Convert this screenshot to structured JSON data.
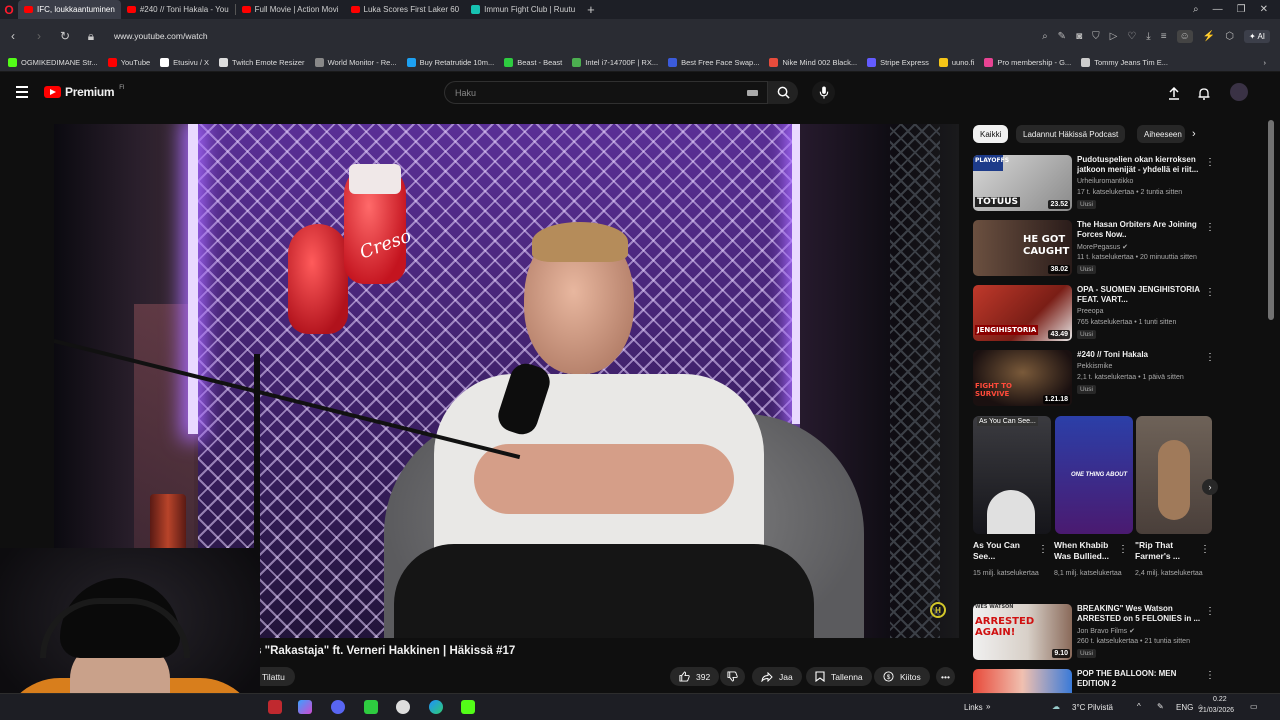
{
  "browser": {
    "tabs": [
      {
        "label": "IFC, loukkaantuminen"
      },
      {
        "label": "#240 // Toni Hakala - You"
      },
      {
        "label": "Full Movie | Action Movi"
      },
      {
        "label": "Luka Scores First Laker 60"
      },
      {
        "label": "Immun Fight Club | Ruutu"
      }
    ],
    "url": "www.youtube.com/watch",
    "ai_label": "AI",
    "bookmarks": [
      {
        "label": "OGMIKEDIMANE Str...",
        "color": "#53fc18"
      },
      {
        "label": "YouTube",
        "color": "#ff0000"
      },
      {
        "label": "Etusivu / X",
        "color": "#ffffff"
      },
      {
        "label": "Twitch Emote Resizer",
        "color": "#dddddd"
      },
      {
        "label": "World Monitor - Re...",
        "color": "#888888"
      },
      {
        "label": "Buy Retatrutide 10m...",
        "color": "#1da1f2"
      },
      {
        "label": "Beast - Beast",
        "color": "#2ecc40"
      },
      {
        "label": "Intel i7-14700F | RX...",
        "color": "#4caf50"
      },
      {
        "label": "Best Free Face Swap...",
        "color": "#3b5bdb"
      },
      {
        "label": "Nike Mind 002 Black...",
        "color": "#e74c3c"
      },
      {
        "label": "Stripe Express",
        "color": "#635bff"
      },
      {
        "label": "uuno.fi",
        "color": "#f5c518"
      },
      {
        "label": "Pro membership - G...",
        "color": "#e84393"
      },
      {
        "label": "Tommy Jeans Tim E...",
        "color": "#cccccc"
      }
    ]
  },
  "youtube": {
    "logo_text": "Premium",
    "logo_sup": "FI",
    "search_placeholder": "Haku",
    "video": {
      "title": "onen vs \"Rakastaja\" ft. Verneri Hakkinen | Häkissä #17",
      "channel_fragment": "n",
      "subscribe_label": "Tilattu",
      "likes": "392",
      "share_label": "Jaa",
      "save_label": "Tallenna",
      "thanks_label": "Kiitos",
      "glove_brand": "Creso"
    },
    "chips": [
      "Kaikki",
      "Ladannut Häkissä Podcast",
      "Aiheeseen"
    ],
    "recommendations": [
      {
        "title": "Pudotuspelien okan kierroksen jatkoon menijät - yhdellä ei riit...",
        "channel": "Urheiluromantikko",
        "meta": "17 t. katselukertaa • 2 tuntia sitten",
        "badge": "Uusi",
        "duration": "23.52",
        "thumb_text": "TOTUUS",
        "thumb_top": "PLAYOFFS"
      },
      {
        "title": "The Hasan Orbiters Are Joining Forces Now..",
        "channel": "MorePegasus",
        "meta": "11 t. katselukertaa • 20 minuuttia sitten",
        "badge": "Uusi",
        "duration": "38.02",
        "thumb_text": "HE GOT CAUGHT"
      },
      {
        "title": "OPA - SUOMEN JENGIHISTORIA FEAT. VART...",
        "channel": "Preeopa",
        "meta": "765 katselukertaa • 1 tunti sitten",
        "badge": "Uusi",
        "duration": "43.49",
        "thumb_text": "JENGIHISTORIA"
      },
      {
        "title": "#240 // Toni Hakala",
        "channel": "Pekkismike",
        "meta": "2,1 t. katselukertaa • 1 päivä sitten",
        "badge": "Uusi",
        "duration": "1.21.18",
        "thumb_text": "FIGHT TO SURVIVE"
      }
    ],
    "shorts": [
      {
        "title": "As You Can See...",
        "views": "15 milj. katselukertaa",
        "overlay": "As You Can See..."
      },
      {
        "title": "When Khabib Was Bullied...",
        "views": "8,1 milj. katselukertaa",
        "overlay": "ONE THING ABOUT"
      },
      {
        "title": "\"Rip That Farmer's ...",
        "views": "2,4 milj. katselukertaa",
        "overlay": ""
      }
    ],
    "recommendations2": [
      {
        "title": "BREAKING\" Wes Watson ARRESTED on 5 FELONIES in ...",
        "channel": "Jon Bravo Films",
        "meta": "260 t. katselukertaa • 21 tuntia sitten",
        "badge": "Uusi",
        "duration": "9.10",
        "thumb_text": "ARRESTED AGAIN!",
        "thumb_top": "WES WATSON"
      },
      {
        "title": "POP THE BALLOON: MEN EDITION 2",
        "channel": "",
        "meta": "",
        "badge": "",
        "duration": "",
        "thumb_text": ""
      }
    ]
  },
  "taskbar": {
    "links_label": "Links",
    "weather": "3°C Pilvistä",
    "lang": "ENG",
    "time": "0.22",
    "date": "21/03/2026"
  },
  "colors": {
    "youtube_red": "#ff0000",
    "background": "#0f0f0f",
    "cage_purple": "#5a2f96"
  }
}
